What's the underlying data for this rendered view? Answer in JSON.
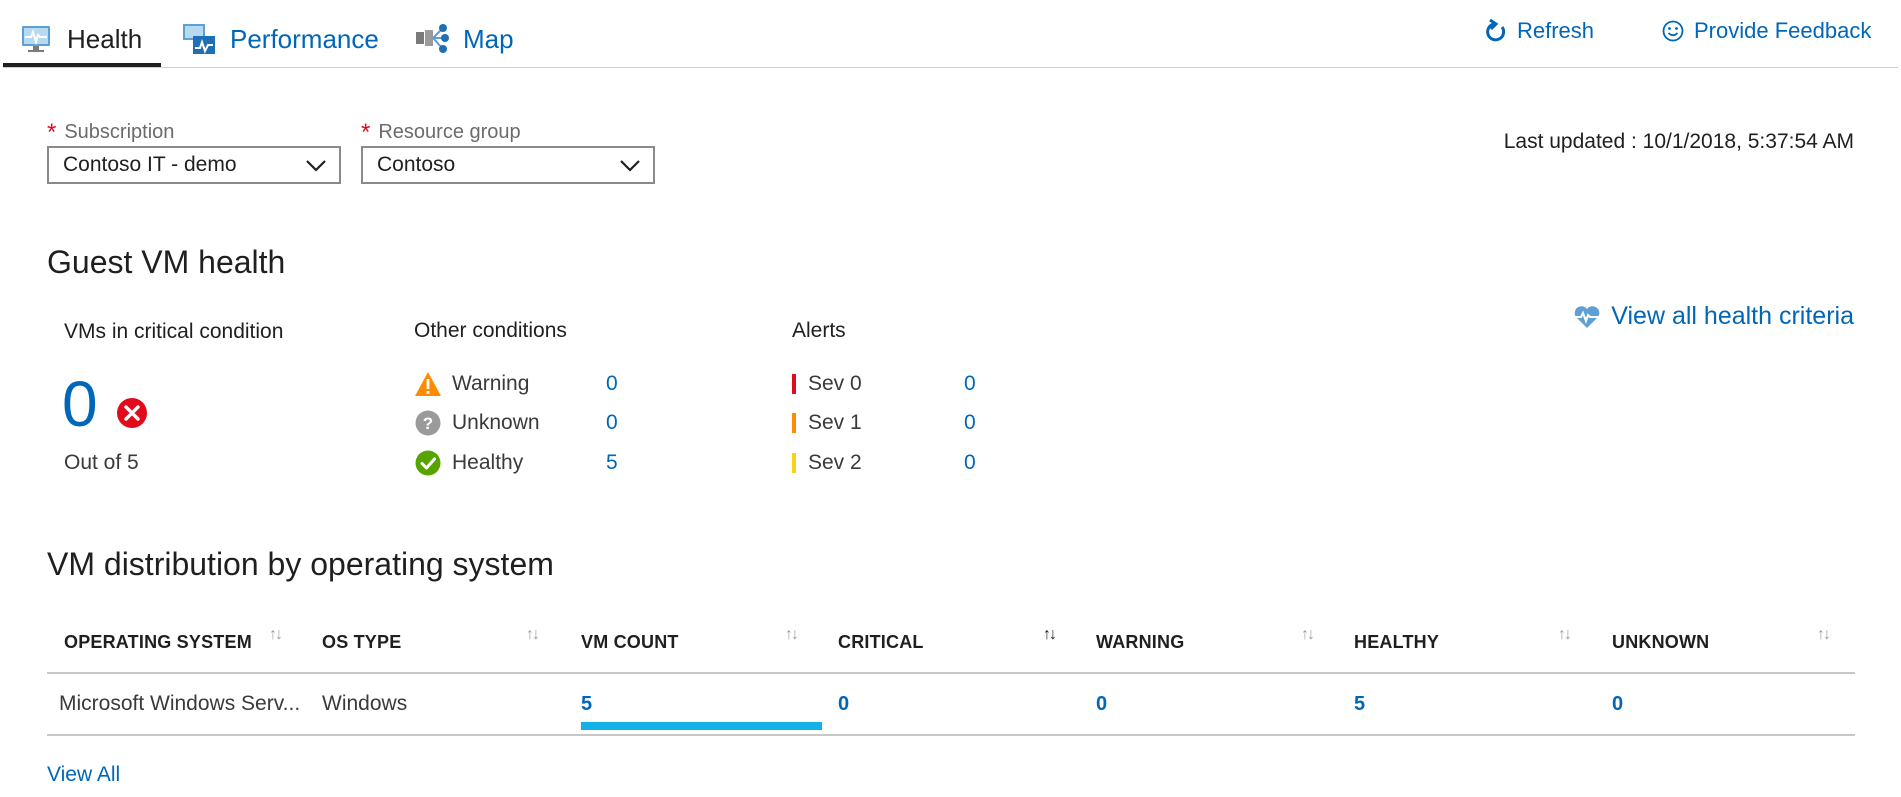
{
  "tabs": [
    {
      "label": "Health",
      "icon": "health-monitor-icon",
      "active": true
    },
    {
      "label": "Performance",
      "icon": "performance-chart-icon",
      "active": false
    },
    {
      "label": "Map",
      "icon": "map-topology-icon",
      "active": false
    }
  ],
  "actions": {
    "refresh_label": "Refresh",
    "feedback_label": "Provide Feedback"
  },
  "filters": {
    "subscription": {
      "label": "Subscription",
      "value": "Contoso IT - demo",
      "required_mark": "*"
    },
    "resource_group": {
      "label": "Resource group",
      "value": "Contoso",
      "required_mark": "*"
    }
  },
  "last_updated": "Last updated : 10/1/2018, 5:37:54 AM",
  "guest_health": {
    "title": "Guest VM health",
    "critical": {
      "title": "VMs in critical condition",
      "count": "0",
      "out_of": "Out of 5"
    },
    "other": {
      "title": "Other conditions",
      "rows": [
        {
          "label": "Warning",
          "value": "0",
          "icon": "warning-icon"
        },
        {
          "label": "Unknown",
          "value": "0",
          "icon": "unknown-icon"
        },
        {
          "label": "Healthy",
          "value": "5",
          "icon": "healthy-check-icon"
        }
      ]
    },
    "alerts": {
      "title": "Alerts",
      "rows": [
        {
          "label": "Sev 0",
          "value": "0",
          "color": "#e00b1c"
        },
        {
          "label": "Sev 1",
          "value": "0",
          "color": "#ff8c00"
        },
        {
          "label": "Sev 2",
          "value": "0",
          "color": "#fcd116"
        }
      ]
    },
    "view_criteria_label": "View all health criteria"
  },
  "distribution": {
    "title": "VM distribution by operating system",
    "columns": [
      "OPERATING SYSTEM",
      "OS TYPE",
      "VM COUNT",
      "CRITICAL",
      "WARNING",
      "HEALTHY",
      "UNKNOWN"
    ],
    "sort_active_column": "CRITICAL",
    "rows": [
      {
        "os": "Microsoft Windows Serv...",
        "os_type": "Windows",
        "vm_count": "5",
        "critical": "0",
        "warning": "0",
        "healthy": "5",
        "unknown": "0",
        "vm_count_fraction": 1.0
      }
    ],
    "view_all_label": "View All"
  },
  "colors": {
    "link": "#0067b8",
    "critical": "#e00b1c",
    "warning": "#ff8c00",
    "healthy": "#57a300",
    "unknown": "#9b9b9b",
    "count_bar": "#14b1e7"
  }
}
